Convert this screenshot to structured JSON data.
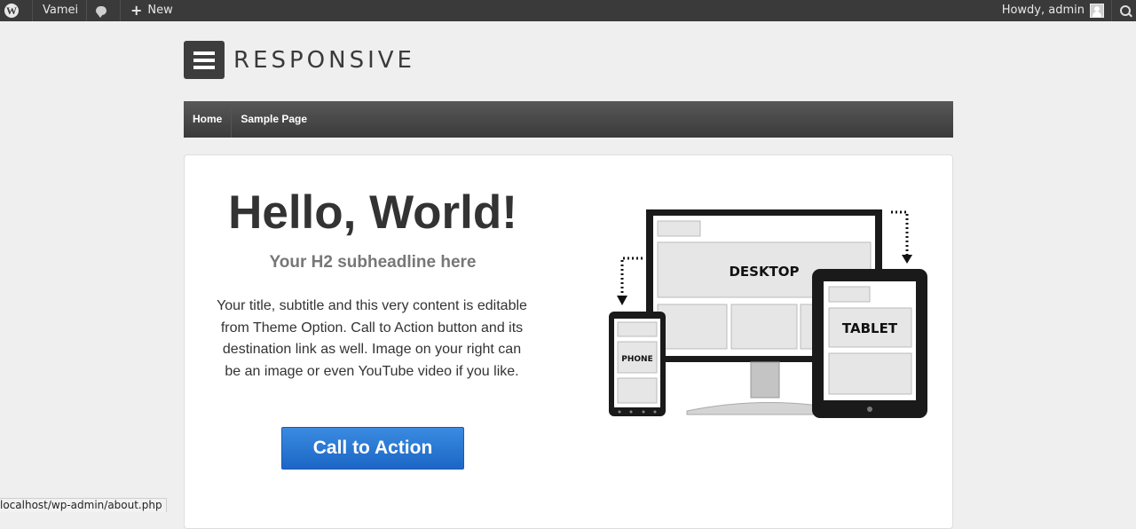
{
  "adminbar": {
    "site_name": "Vamei",
    "new_label": "New",
    "howdy": "Howdy, admin"
  },
  "logo": {
    "text": "RESPONSIVE"
  },
  "nav": {
    "items": [
      "Home",
      "Sample Page"
    ]
  },
  "hero": {
    "title": "Hello, World!",
    "subtitle": "Your H2 subheadline here",
    "body": "Your title, subtitle and this very content is editable from Theme Option. Call to Action button and its destination link as well. Image on your right can be an image or even YouTube video if you like.",
    "cta_label": "Call to Action",
    "image_labels": {
      "desktop": "DESKTOP",
      "tablet": "TABLET",
      "phone": "PHONE"
    }
  },
  "statusbar": {
    "url": "localhost/wp-admin/about.php"
  },
  "colors": {
    "adminbar": "#3a3a3a",
    "nav": "#3a3a3a",
    "cta": "#1c66c6",
    "page_bg": "#efefef"
  }
}
